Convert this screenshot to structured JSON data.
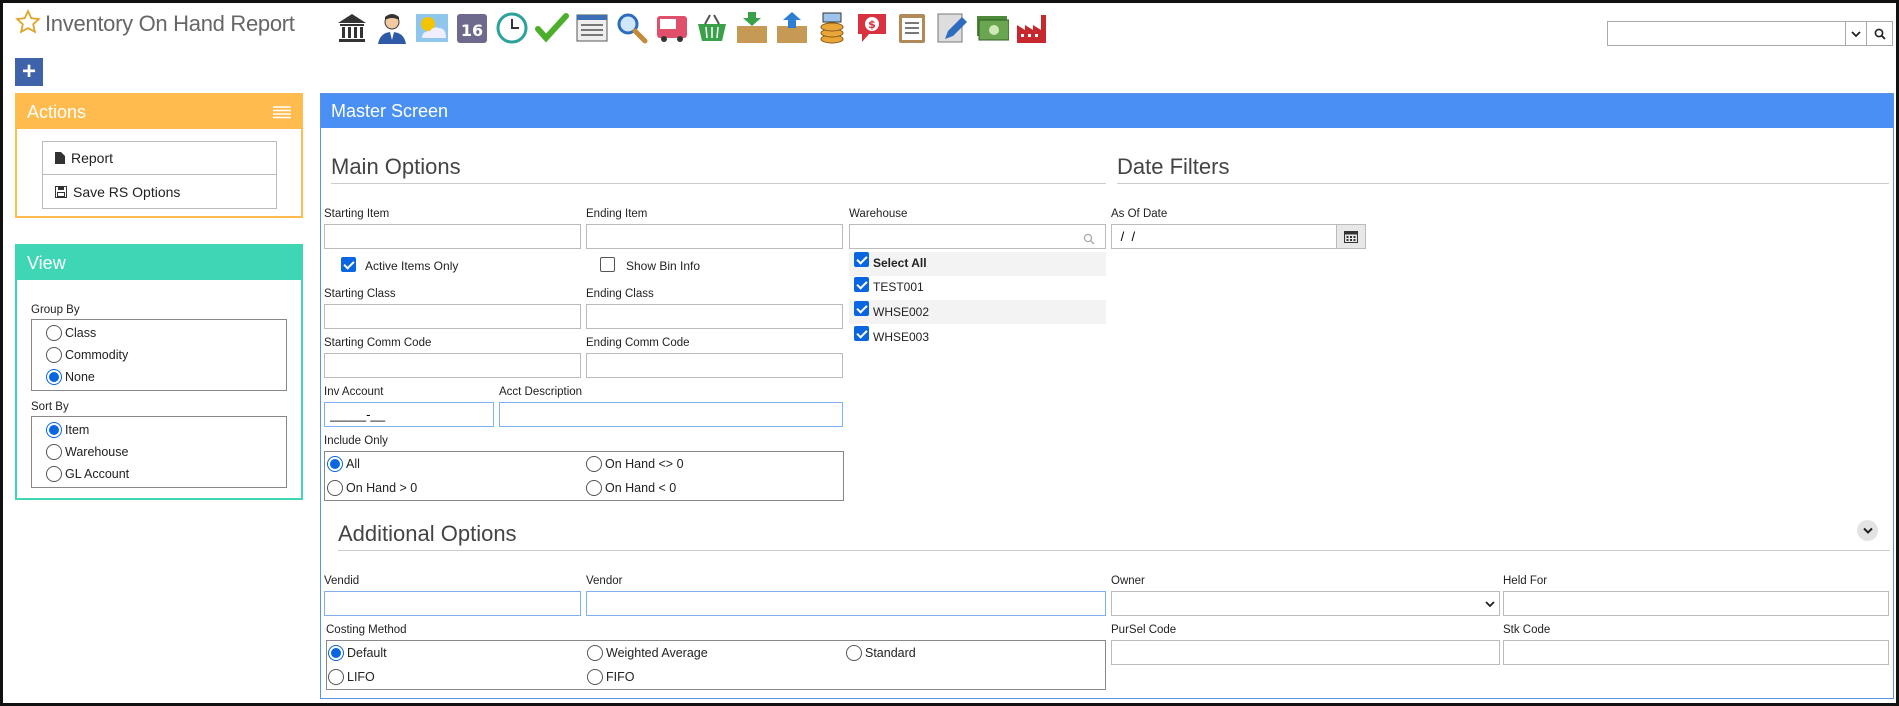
{
  "header": {
    "title": "Inventory On Hand Report"
  },
  "toolbar": {
    "icons": [
      "bank-icon",
      "user-icon",
      "weather-icon",
      "calendar-16-icon",
      "clock-icon",
      "checkmark-icon",
      "list-window-icon",
      "magnifier-icon",
      "truck-icon",
      "basket-icon",
      "box-down-icon",
      "box-up-icon",
      "coins-icon",
      "dollar-speech-icon",
      "clipboard-icon",
      "pencil-icon",
      "cash-icon",
      "factory-icon"
    ],
    "calendar_number": "16"
  },
  "search": {
    "value": "",
    "placeholder": ""
  },
  "actions": {
    "title": "Actions",
    "items": [
      {
        "label": "Report"
      },
      {
        "label": "Save RS Options"
      }
    ]
  },
  "view": {
    "title": "View",
    "group_by_label": "Group By",
    "group_by": [
      "Class",
      "Commodity",
      "None"
    ],
    "group_by_selected": "None",
    "sort_by_label": "Sort By",
    "sort_by": [
      "Item",
      "Warehouse",
      "GL Account"
    ],
    "sort_by_selected": "Item"
  },
  "master": {
    "title": "Master Screen"
  },
  "main_options": {
    "title": "Main Options",
    "starting_item": {
      "label": "Starting Item",
      "value": ""
    },
    "ending_item": {
      "label": "Ending Item",
      "value": ""
    },
    "active_items_only": {
      "label": "Active Items Only",
      "checked": true
    },
    "show_bin_info": {
      "label": "Show Bin Info",
      "checked": false
    },
    "starting_class": {
      "label": "Starting Class",
      "value": ""
    },
    "ending_class": {
      "label": "Ending Class",
      "value": ""
    },
    "starting_comm_code": {
      "label": "Starting Comm Code",
      "value": ""
    },
    "ending_comm_code": {
      "label": "Ending Comm Code",
      "value": ""
    },
    "inv_account": {
      "label": "Inv Account",
      "value": "_____-__"
    },
    "acct_description": {
      "label": "Acct Description",
      "value": ""
    },
    "include_only": {
      "label": "Include Only",
      "options": [
        "All",
        "On Hand <> 0",
        "On Hand > 0",
        "On Hand < 0"
      ],
      "selected": "All"
    }
  },
  "warehouse": {
    "label": "Warehouse",
    "value": "",
    "items": [
      {
        "label": "Select All",
        "checked": true
      },
      {
        "label": "TEST001",
        "checked": true
      },
      {
        "label": "WHSE002",
        "checked": true
      },
      {
        "label": "WHSE003",
        "checked": true
      }
    ]
  },
  "date_filters": {
    "title": "Date Filters",
    "as_of_date": {
      "label": "As Of Date",
      "value": " /  /"
    }
  },
  "additional_options": {
    "title": "Additional Options",
    "vendid": {
      "label": "Vendid",
      "value": ""
    },
    "vendor": {
      "label": "Vendor",
      "value": ""
    },
    "owner": {
      "label": "Owner",
      "value": ""
    },
    "held_for": {
      "label": "Held For",
      "value": ""
    },
    "pursel_code": {
      "label": "PurSel Code",
      "value": ""
    },
    "stk_code": {
      "label": "Stk Code",
      "value": ""
    },
    "costing_method": {
      "label": "Costing Method",
      "options": [
        "Default",
        "Weighted Average",
        "Standard",
        "LIFO",
        "FIFO"
      ],
      "selected": "Default"
    }
  },
  "colors": {
    "actions": "#ffbb4d",
    "view": "#3fd6b6",
    "master": "#4a8ff3",
    "accent": "#0a66e0"
  }
}
